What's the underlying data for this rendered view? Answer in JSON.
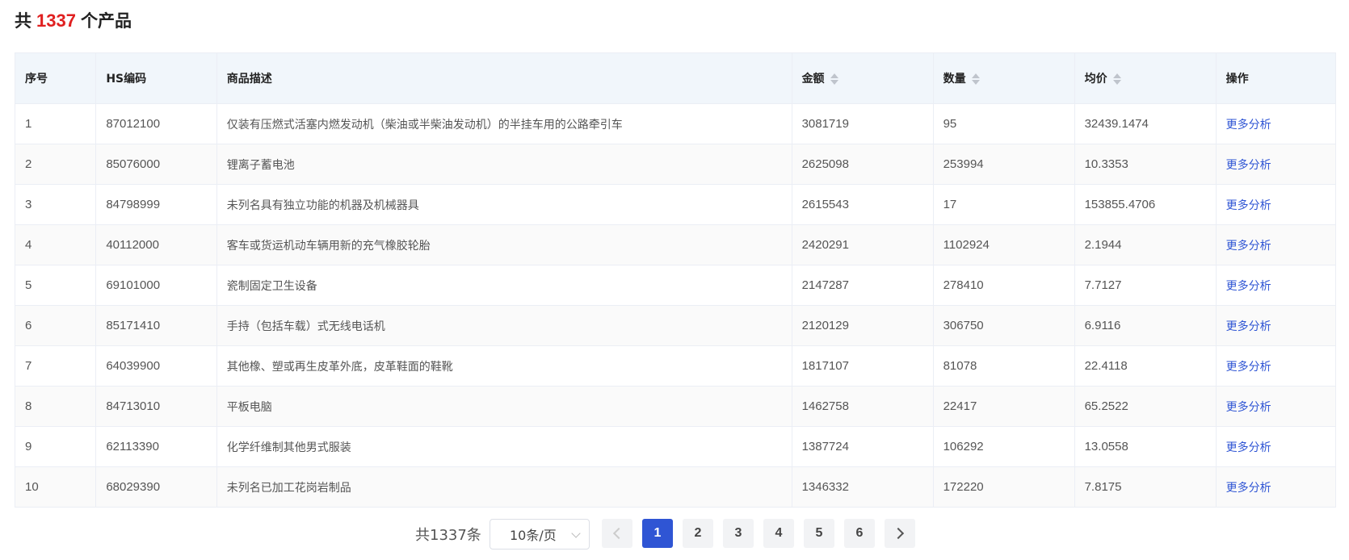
{
  "heading": {
    "prefix": "共",
    "count": "1337",
    "suffix": "个产品"
  },
  "table": {
    "columns": [
      "序号",
      "HS编码",
      "商品描述",
      "金额",
      "数量",
      "均价",
      "操作"
    ],
    "rows": [
      [
        "1",
        "87012100",
        "仅装有压燃式活塞内燃发动机（柴油或半柴油发动机）的半挂车用的公路牵引车",
        "3081719",
        "95",
        "32439.1474",
        "更多分析"
      ],
      [
        "2",
        "85076000",
        "锂离子蓄电池",
        "2625098",
        "253994",
        "10.3353",
        "更多分析"
      ],
      [
        "3",
        "84798999",
        "未列名具有独立功能的机器及机械器具",
        "2615543",
        "17",
        "153855.4706",
        "更多分析"
      ],
      [
        "4",
        "40112000",
        "客车或货运机动车辆用新的充气橡胶轮胎",
        "2420291",
        "1102924",
        "2.1944",
        "更多分析"
      ],
      [
        "5",
        "69101000",
        "瓷制固定卫生设备",
        "2147287",
        "278410",
        "7.7127",
        "更多分析"
      ],
      [
        "6",
        "85171410",
        "手持（包括车载）式无线电话机",
        "2120129",
        "306750",
        "6.9116",
        "更多分析"
      ],
      [
        "7",
        "64039900",
        "其他橡、塑或再生皮革外底，皮革鞋面的鞋靴",
        "1817107",
        "81078",
        "22.4118",
        "更多分析"
      ],
      [
        "8",
        "84713010",
        "平板电脑",
        "1462758",
        "22417",
        "65.2522",
        "更多分析"
      ],
      [
        "9",
        "62113390",
        "化学纤维制其他男式服装",
        "1387724",
        "106292",
        "13.0558",
        "更多分析"
      ],
      [
        "10",
        "68029390",
        "未列名已加工花岗岩制品",
        "1346332",
        "172220",
        "7.8175",
        "更多分析"
      ]
    ]
  },
  "pagination": {
    "total_text": "共1337条",
    "page_size": "10条/页",
    "pages": [
      "1",
      "2",
      "3",
      "4",
      "5",
      "6"
    ],
    "current": "1",
    "prev_icon": "chevron-left-icon",
    "next_icon": "chevron-right-icon"
  },
  "colors": {
    "accent": "#2f55d4",
    "count_red": "#e02020",
    "header_bg": "#f1f6fb"
  }
}
